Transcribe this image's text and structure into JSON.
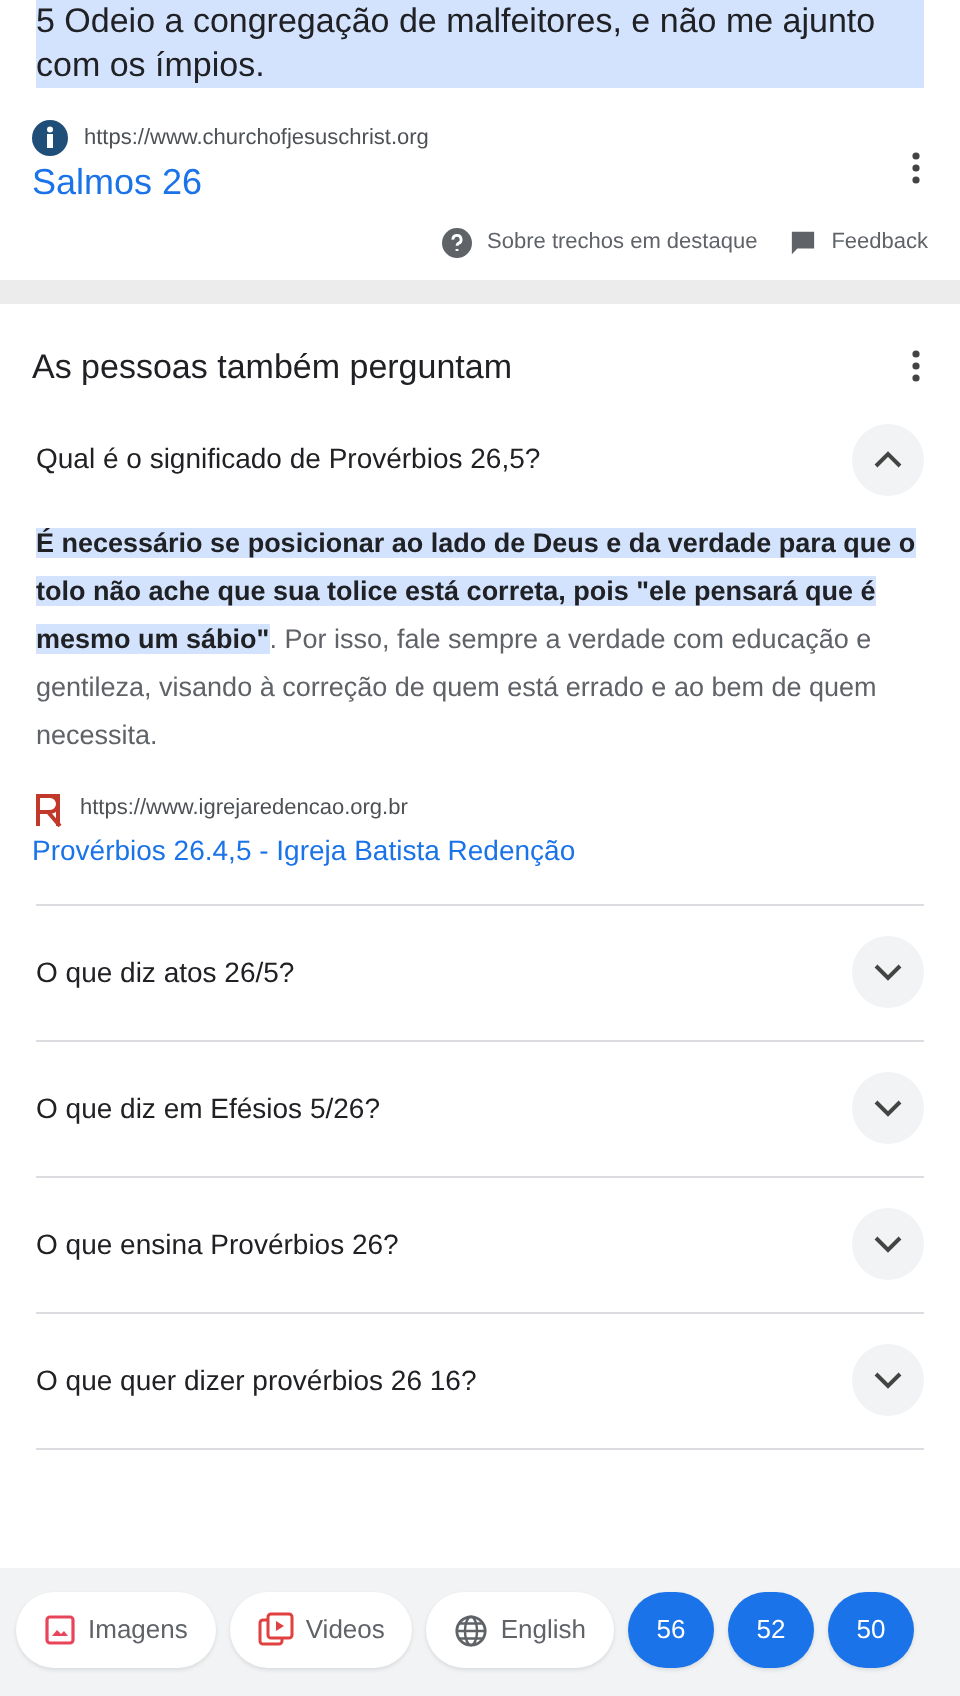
{
  "snippet": {
    "text": "5 Odeio a congregação de malfeitores, e não me ajunto com os ímpios.",
    "source_url": "https://www.churchofjesuschrist.org",
    "title": "Salmos 26",
    "about_link": "Sobre trechos em destaque",
    "feedback_link": "Feedback"
  },
  "people_also_ask": {
    "heading": "As pessoas também perguntam",
    "questions": [
      {
        "question": "Qual é o significado de Provérbios 26,5?",
        "expanded": true,
        "answer": "**É necessário se posicionar ao lado de Deus e da verdade para que o tolo não ache que sua tolice está correta, pois \"ele pensará que é mesmo um sábio\"**. Por isso, fale sempre a verdade com educação e gentileza, visando à correção de quem está errado e ao bem de quem necessita.",
        "source_url": "https://www.igrejaredencao.org.br",
        "source_title": "Provérbios 26.4,5 - Igreja Batista Redenção"
      },
      {
        "question": "O que diz atos 26/5?",
        "expanded": false
      },
      {
        "question": "O que diz em Efésios 5/26?",
        "expanded": false
      },
      {
        "question": "O que ensina Provérbios 26?",
        "expanded": false
      },
      {
        "question": "O que quer dizer provérbios 26 16?",
        "expanded": false
      }
    ]
  },
  "chips": [
    {
      "kind": "images",
      "label": "Imagens"
    },
    {
      "kind": "videos",
      "label": "Videos"
    },
    {
      "kind": "language",
      "label": "English"
    },
    {
      "kind": "number",
      "label": "56"
    },
    {
      "kind": "number",
      "label": "52"
    },
    {
      "kind": "number",
      "label": "50"
    }
  ]
}
